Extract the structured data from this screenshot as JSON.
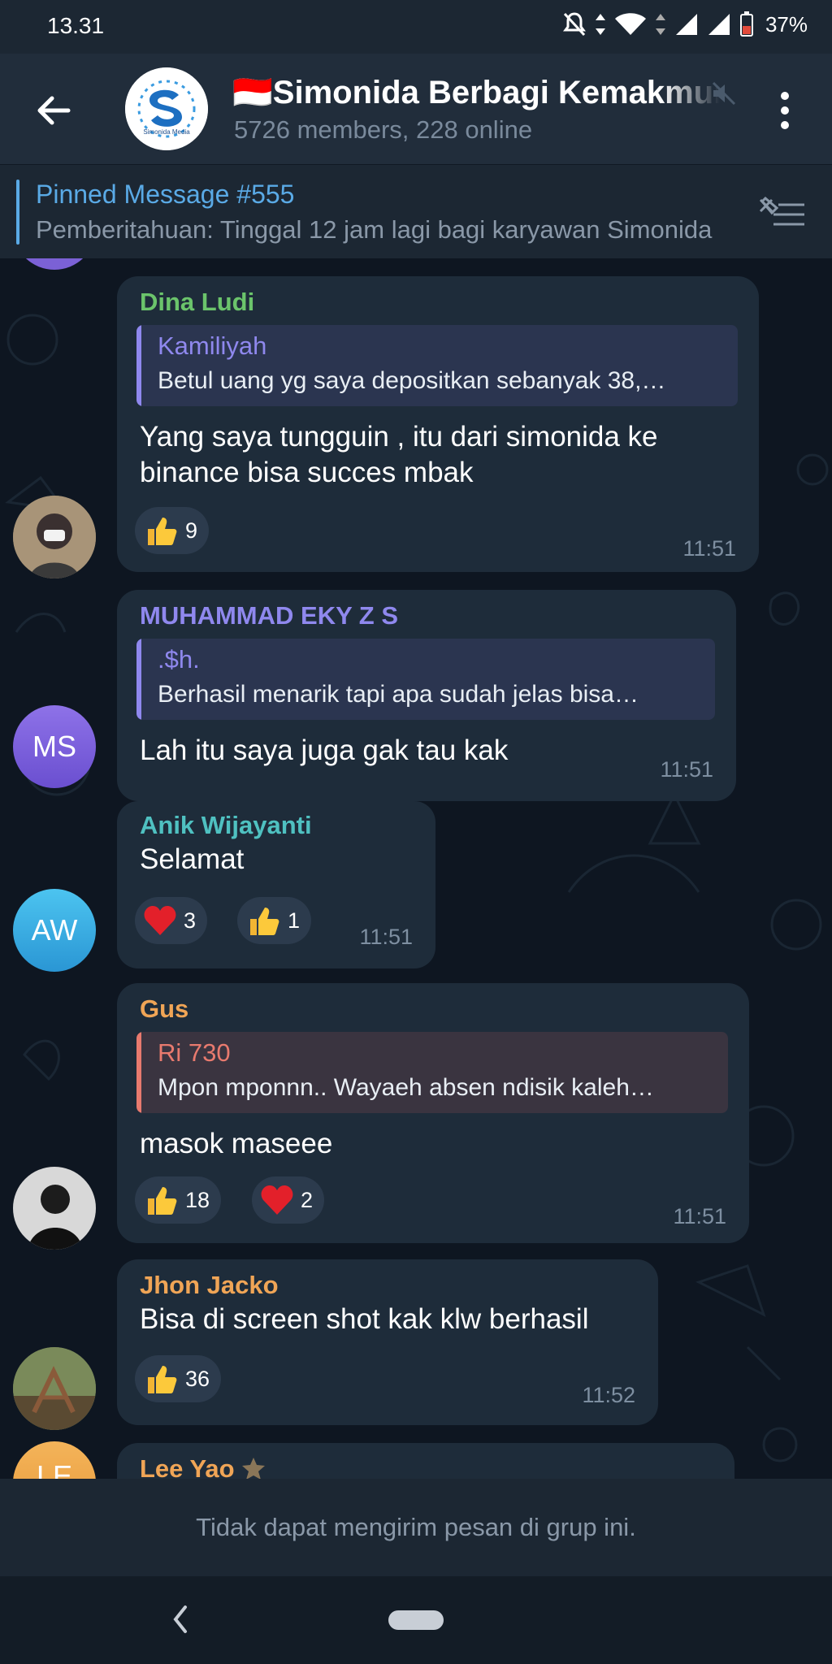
{
  "status_bar": {
    "time": "13.31",
    "battery": "37%"
  },
  "header": {
    "title": "🇮🇩Simonida Berbagi Kemakmuran",
    "subtitle": "5726 members, 228 online",
    "avatar_text": "Simonida Media"
  },
  "pinned": {
    "title": "Pinned Message #555",
    "text": "Pemberitahuan: Tinggal 12 jam lagi bagi karyawan Simonida"
  },
  "messages": [
    {
      "sender": "Dina Ludi",
      "sender_color": "#6bc46b",
      "reply_name": "Kamiliyah",
      "reply_color": "#8f88ee",
      "reply_text": "Betul uang yg saya depositkan sebanyak 38,…",
      "text_line1": "Yang saya tungguin , itu dari simonida ke",
      "text_line2": "binance bisa succes mbak",
      "reactions": [
        {
          "emoji": "thumbs-up-icon",
          "count": "9"
        }
      ],
      "time": "11:51"
    },
    {
      "sender": "MUHAMMAD EKY Z S",
      "sender_color": "#8f88ee",
      "reply_name": ".$h.",
      "reply_color": "#8f88ee",
      "reply_text": "Berhasil menarik tapi apa sudah jelas bisa…",
      "text_line1": "Lah itu saya juga gak tau kak",
      "avatar_initials": "MS",
      "time": "11:51"
    },
    {
      "sender": "Anik Wijayanti",
      "sender_color": "#4fc1c1",
      "text_line1": "Selamat",
      "avatar_initials": "AW",
      "reactions": [
        {
          "emoji": "heart-icon",
          "count": "3"
        },
        {
          "emoji": "thumbs-up-icon",
          "count": "1"
        }
      ],
      "time": "11:51"
    },
    {
      "sender": "Gus",
      "sender_color": "#f0a556",
      "reply_name": "Ri 730",
      "reply_color": "#e87a6e",
      "reply_text": "Mpon mponnn.. Wayaeh absen ndisik kaleh…",
      "text_line1": "masok maseee",
      "reactions": [
        {
          "emoji": "thumbs-up-icon",
          "count": "18"
        },
        {
          "emoji": "heart-icon",
          "count": "2"
        }
      ],
      "time": "11:51"
    },
    {
      "sender": "Jhon Jacko",
      "sender_color": "#f0a556",
      "text_line1": "Bisa di screen shot kak klw berhasil",
      "reactions": [
        {
          "emoji": "thumbs-up-icon",
          "count": "36"
        }
      ],
      "time": "11:52"
    },
    {
      "sender": "Lee Yao",
      "sender_color": "#f0a556",
      "avatar_initials": "LE"
    }
  ],
  "bottom_notice": "Tidak dapat mengirim pesan di grup ini.",
  "colors": {
    "background": "#0e1621",
    "bubble": "#1e2c3a",
    "header": "#212d3b",
    "accent": "#5aaae6"
  }
}
